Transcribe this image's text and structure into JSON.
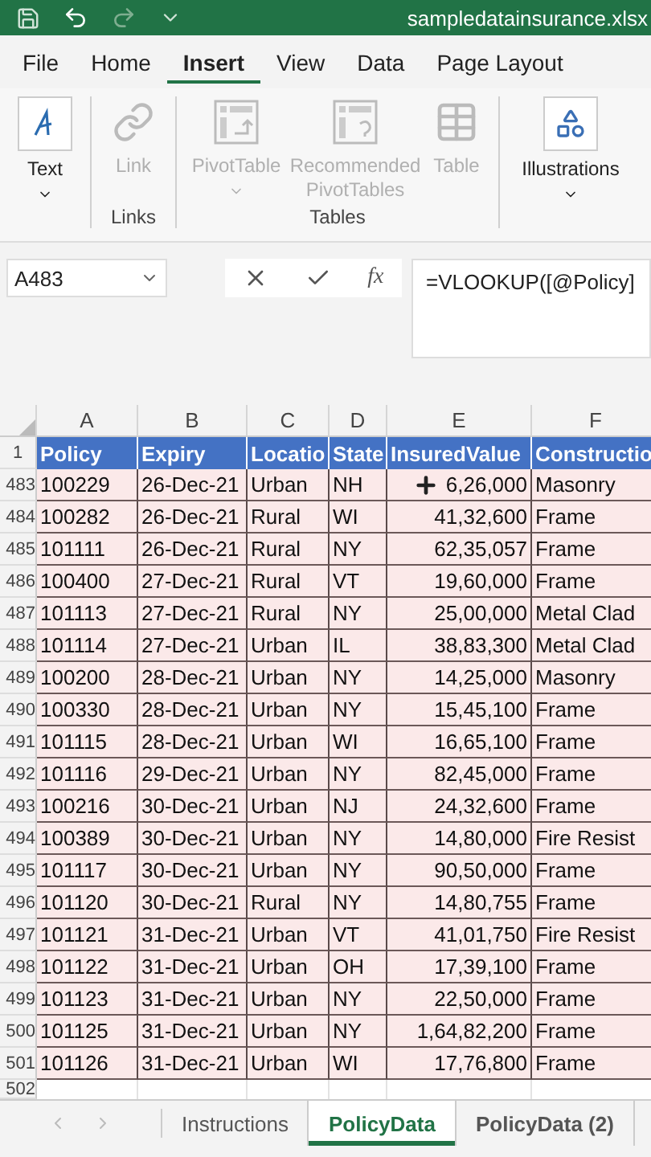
{
  "title_bar": {
    "filename": "sampledatainsurance.xlsx"
  },
  "ribbon_tabs": [
    {
      "label": "File",
      "selected": false
    },
    {
      "label": "Home",
      "selected": false
    },
    {
      "label": "Insert",
      "selected": true
    },
    {
      "label": "View",
      "selected": false
    },
    {
      "label": "Data",
      "selected": false
    },
    {
      "label": "Page Layout",
      "selected": false
    }
  ],
  "ribbon_groups": [
    {
      "commands": [
        {
          "kind": "text",
          "label": "Text",
          "disabled": false,
          "dropdown": true
        }
      ]
    },
    {
      "label": "Links",
      "commands": [
        {
          "kind": "link",
          "label": "Link",
          "disabled": true,
          "dropdown": false
        }
      ]
    },
    {
      "label": "Tables",
      "commands": [
        {
          "kind": "pivot",
          "label": "PivotTable",
          "disabled": true,
          "dropdown": true
        },
        {
          "kind": "recommended",
          "label": "Recommended PivotTables",
          "disabled": true,
          "dropdown": false
        },
        {
          "kind": "table",
          "label": "Table",
          "disabled": true,
          "dropdown": false
        }
      ]
    },
    {
      "commands": [
        {
          "kind": "illustrations",
          "label": "Illustrations",
          "disabled": false,
          "dropdown": true
        }
      ]
    }
  ],
  "formula_bar": {
    "name_box": "A483",
    "function_label": "fx",
    "formula": "=VLOOKUP([@Policy]"
  },
  "sheet": {
    "column_letters": [
      "A",
      "B",
      "C",
      "D",
      "E",
      "F"
    ],
    "header_row": {
      "number": "1",
      "cells": [
        "Policy",
        "Expiry",
        "Locatio",
        "State",
        "InsuredValue",
        "Constructio"
      ]
    },
    "rows": [
      {
        "number": "483",
        "cells": [
          "100229",
          "26-Dec-21",
          "Urban",
          "NH",
          "6,26,000",
          "Masonry"
        ]
      },
      {
        "number": "484",
        "cells": [
          "100282",
          "26-Dec-21",
          "Rural",
          "WI",
          "41,32,600",
          "Frame"
        ]
      },
      {
        "number": "485",
        "cells": [
          "101111",
          "26-Dec-21",
          "Rural",
          "NY",
          "62,35,057",
          "Frame"
        ]
      },
      {
        "number": "486",
        "cells": [
          "100400",
          "27-Dec-21",
          "Rural",
          "VT",
          "19,60,000",
          "Frame"
        ]
      },
      {
        "number": "487",
        "cells": [
          "101113",
          "27-Dec-21",
          "Rural",
          "NY",
          "25,00,000",
          "Metal Clad"
        ]
      },
      {
        "number": "488",
        "cells": [
          "101114",
          "27-Dec-21",
          "Urban",
          "IL",
          "38,83,300",
          "Metal Clad"
        ]
      },
      {
        "number": "489",
        "cells": [
          "100200",
          "28-Dec-21",
          "Urban",
          "NY",
          "14,25,000",
          "Masonry"
        ]
      },
      {
        "number": "490",
        "cells": [
          "100330",
          "28-Dec-21",
          "Urban",
          "NY",
          "15,45,100",
          "Frame"
        ]
      },
      {
        "number": "491",
        "cells": [
          "101115",
          "28-Dec-21",
          "Urban",
          "WI",
          "16,65,100",
          "Frame"
        ]
      },
      {
        "number": "492",
        "cells": [
          "101116",
          "29-Dec-21",
          "Urban",
          "NY",
          "82,45,000",
          "Frame"
        ]
      },
      {
        "number": "493",
        "cells": [
          "100216",
          "30-Dec-21",
          "Urban",
          "NJ",
          "24,32,600",
          "Frame"
        ]
      },
      {
        "number": "494",
        "cells": [
          "100389",
          "30-Dec-21",
          "Urban",
          "NY",
          "14,80,000",
          "Fire Resist"
        ]
      },
      {
        "number": "495",
        "cells": [
          "101117",
          "30-Dec-21",
          "Urban",
          "NY",
          "90,50,000",
          "Frame"
        ]
      },
      {
        "number": "496",
        "cells": [
          "101120",
          "30-Dec-21",
          "Rural",
          "NY",
          "14,80,755",
          "Frame"
        ]
      },
      {
        "number": "497",
        "cells": [
          "101121",
          "31-Dec-21",
          "Urban",
          "VT",
          "41,01,750",
          "Fire Resist"
        ]
      },
      {
        "number": "498",
        "cells": [
          "101122",
          "31-Dec-21",
          "Urban",
          "OH",
          "17,39,100",
          "Frame"
        ]
      },
      {
        "number": "499",
        "cells": [
          "101123",
          "31-Dec-21",
          "Urban",
          "NY",
          "22,50,000",
          "Frame"
        ]
      },
      {
        "number": "500",
        "cells": [
          "101125",
          "31-Dec-21",
          "Urban",
          "NY",
          "1,64,82,200",
          "Frame"
        ]
      },
      {
        "number": "501",
        "cells": [
          "101126",
          "31-Dec-21",
          "Urban",
          "WI",
          "17,76,800",
          "Frame"
        ]
      }
    ],
    "partial_row": {
      "number": "502"
    }
  },
  "sheet_tabs": [
    {
      "label": "Instructions",
      "selected": false,
      "bold": false
    },
    {
      "label": "PolicyData",
      "selected": true,
      "bold": true
    },
    {
      "label": "PolicyData (2)",
      "selected": false,
      "bold": true
    }
  ]
}
